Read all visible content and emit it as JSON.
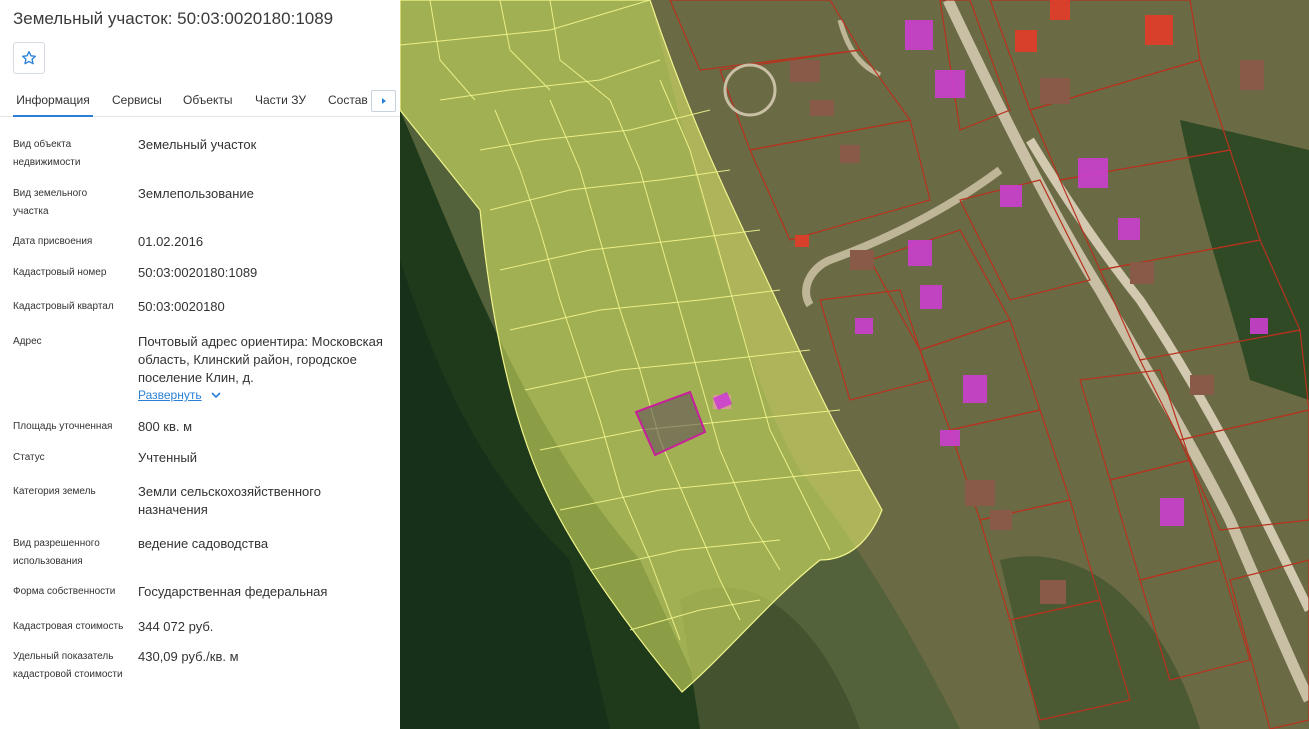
{
  "header": {
    "title": "Земельный участок: 50:03:0020180:1089"
  },
  "tabs": [
    {
      "label": "Информация",
      "active": true
    },
    {
      "label": "Сервисы"
    },
    {
      "label": "Объекты"
    },
    {
      "label": "Части ЗУ"
    },
    {
      "label": "Состав ЕЗП"
    }
  ],
  "fields": [
    {
      "label": "Вид объекта недвижимости",
      "value": "Земельный участок"
    },
    {
      "label": "Вид земельного участка",
      "value": "Землепользование"
    },
    {
      "label": "Дата присвоения",
      "value": "01.02.2016"
    },
    {
      "label": "Кадастровый номер",
      "value": "50:03:0020180:1089"
    },
    {
      "label": "Кадастровый квартал",
      "value": "50:03:0020180"
    },
    {
      "label": "Адрес",
      "value": "Почтовый адрес ориентира: Московская область, Клинский район, городское поселение Клин, д."
    },
    {
      "label": "Площадь уточненная",
      "value": "800 кв. м"
    },
    {
      "label": "Статус",
      "value": "Учтенный"
    },
    {
      "label": "Категория земель",
      "value": "Земли сельскохозяйственного назначения"
    },
    {
      "label": "Вид разрешенного использования",
      "value": "ведение садоводства"
    },
    {
      "label": "Форма собственности",
      "value": "Государственная федеральная"
    },
    {
      "label": "Кадастровая стоимость",
      "value": "344 072 руб."
    },
    {
      "label": "Удельный показатель кадастровой стоимости",
      "value": "430,09 руб./кв. м"
    }
  ],
  "address_expand_label": "Развернуть",
  "icons": {
    "favorite": "star-icon",
    "tabs_next": "caret-right-icon",
    "expand": "chevron-down-icon"
  },
  "colors": {
    "accent": "#2b7fd6",
    "parcel_fill": "#e3f06a",
    "parcel_stroke": "#f2f58c",
    "selected_parcel": "#c8209a",
    "building": "#cc3fcf",
    "cadastre_lines": "#b8321e"
  }
}
